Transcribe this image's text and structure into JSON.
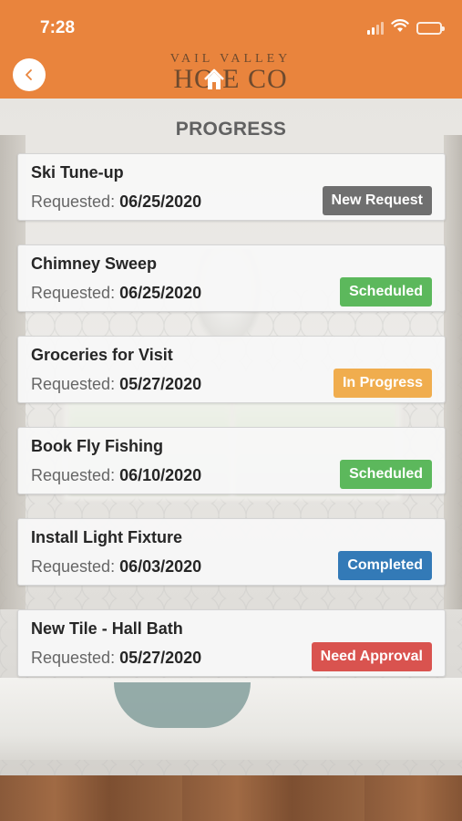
{
  "status_bar": {
    "time": "7:28",
    "icons": [
      "signal-icon",
      "wifi-icon",
      "battery-icon"
    ]
  },
  "header": {
    "background_color": "#e9843d",
    "back_icon": "chevron-left-icon",
    "logo": {
      "line1": "VAIL VALLEY",
      "line2": "HO E CO",
      "house_icon": "house-icon",
      "color": "#6e4a2e"
    }
  },
  "page": {
    "title": "PROGRESS",
    "requested_label": "Requested:"
  },
  "requests": [
    {
      "title": "Ski Tune-up",
      "date": "06/25/2020",
      "status": "New Request",
      "status_color": "#6f6f6f"
    },
    {
      "title": "Chimney Sweep",
      "date": "06/25/2020",
      "status": "Scheduled",
      "status_color": "#5cb85c"
    },
    {
      "title": "Groceries for Visit",
      "date": "05/27/2020",
      "status": "In Progress",
      "status_color": "#f0ad4e"
    },
    {
      "title": "Book Fly Fishing",
      "date": "06/10/2020",
      "status": "Scheduled",
      "status_color": "#5cb85c"
    },
    {
      "title": "Install Light Fixture",
      "date": "06/03/2020",
      "status": "Completed",
      "status_color": "#337ab7"
    },
    {
      "title": "New Tile - Hall Bath",
      "date": "05/27/2020",
      "status": "Need Approval",
      "status_color": "#d9534f"
    }
  ]
}
